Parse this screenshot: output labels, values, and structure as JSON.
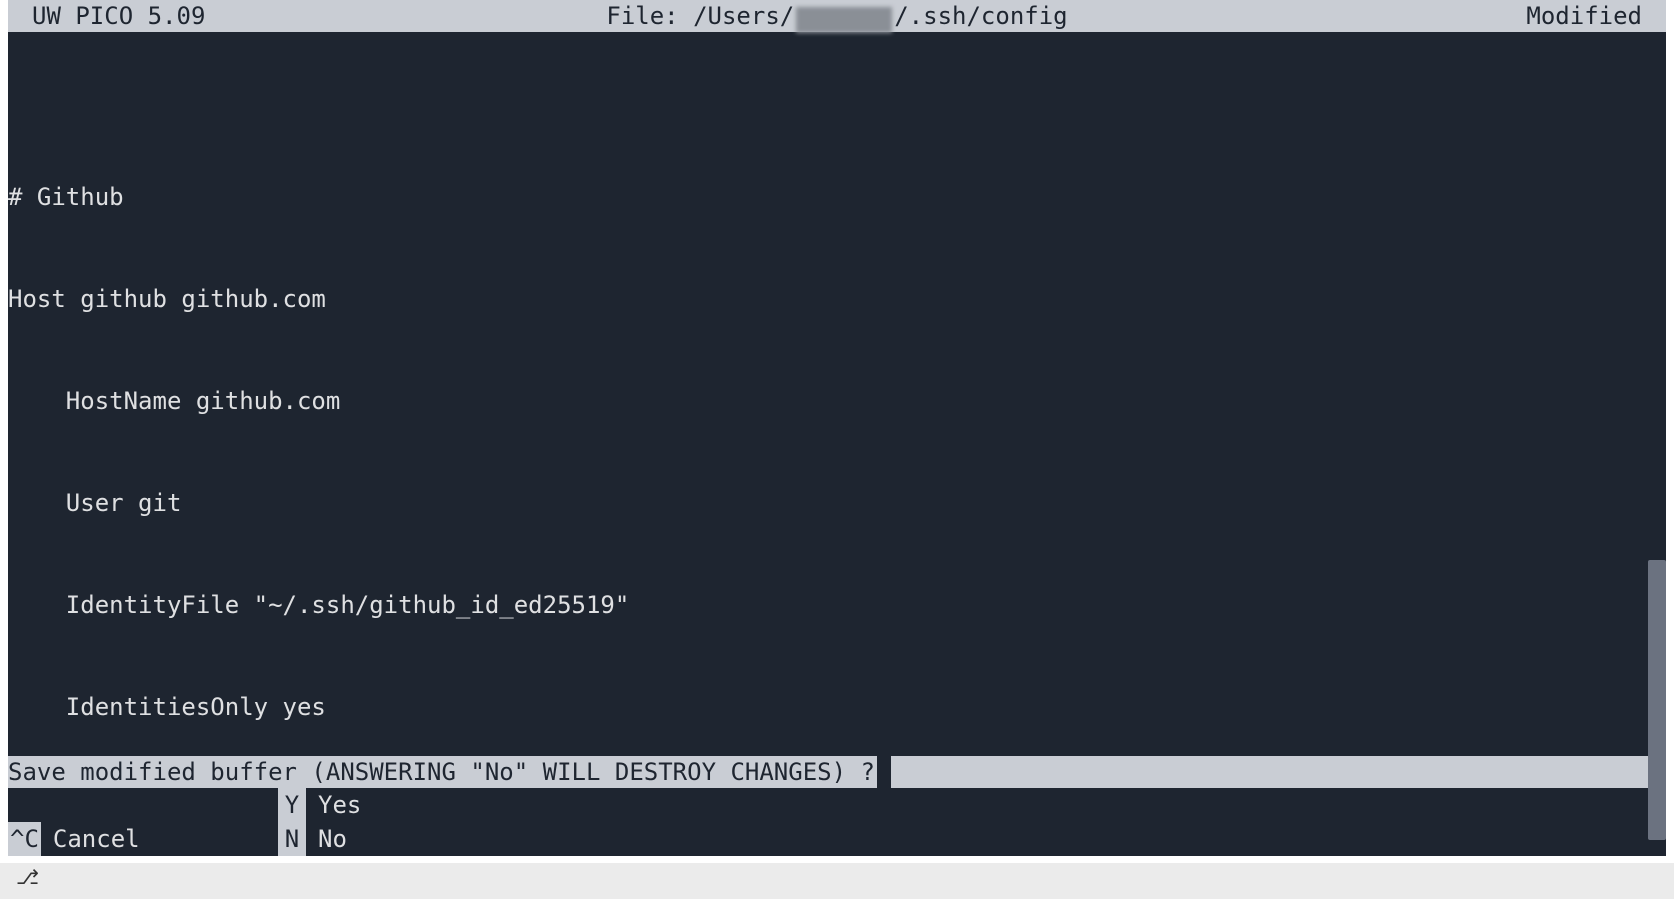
{
  "title_bar": {
    "app_name": "UW PICO 5.09",
    "file_prefix": "File: /Users/",
    "file_suffix": "/.ssh/config",
    "status": "Modified"
  },
  "editor": {
    "lines": [
      "",
      "# Github",
      "Host github github.com",
      "    HostName github.com",
      "    User git",
      "    IdentityFile \"~/.ssh/github_id_ed25519\"",
      "    IdentitiesOnly yes"
    ]
  },
  "prompt": {
    "text": "Save modified buffer (ANSWERING \"No\" WILL DESTROY CHANGES) ? "
  },
  "shortcuts": {
    "rows": [
      [
        {
          "key": "",
          "label": ""
        },
        {
          "key": " Y",
          "label": "Yes"
        }
      ],
      [
        {
          "key": "^C",
          "label": "Cancel"
        },
        {
          "key": " N",
          "label": "No"
        }
      ]
    ]
  },
  "bottom": {
    "branch_glyph": "⎇"
  }
}
